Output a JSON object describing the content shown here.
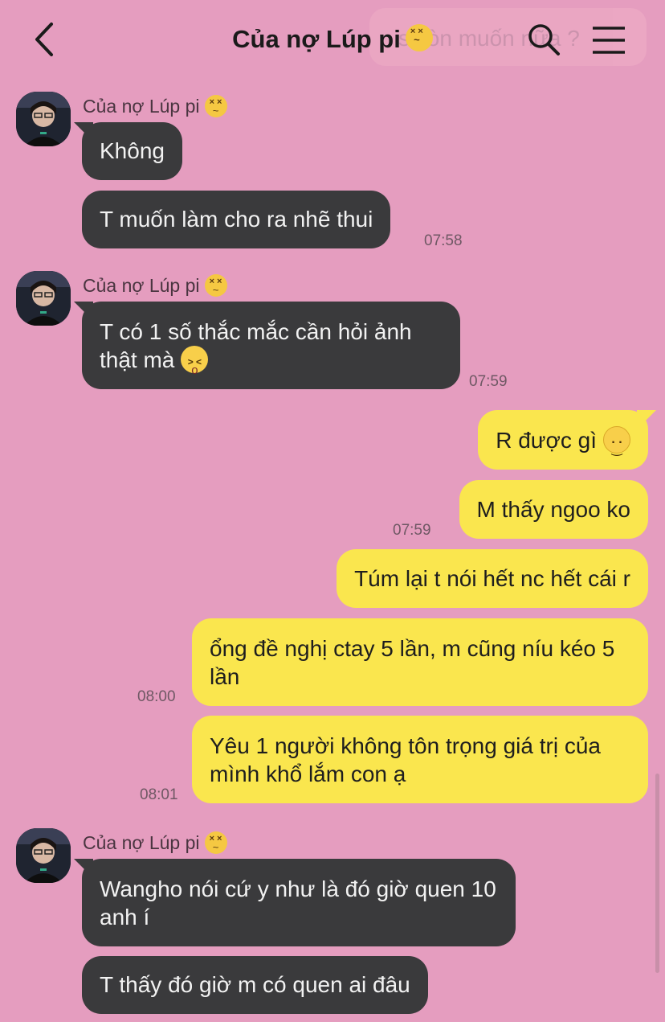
{
  "header": {
    "title": "Của nợ Lúp pi",
    "ghost_preview": "s còn muốn nữa ?"
  },
  "contact": {
    "name": "Của nợ Lúp pi",
    "name_emoji": "confounded-face"
  },
  "messages": {
    "m1": "Không",
    "m2": "T muốn làm cho ra nhẽ thui",
    "t2": "07:58",
    "m3": "T có 1 số thắc mắc cần hỏi ảnh thật mà",
    "t3": "07:59",
    "m4": "R được gì",
    "m5": "M thấy ngoo ko",
    "t5": "07:59",
    "m6": "Túm lại t nói hết nc hết cái r",
    "m7": "ổng đề nghị ctay 5 lần, m cũng níu kéo 5 lần",
    "t7": "08:00",
    "m8": "Yêu 1 người không tôn trọng giá trị của mình khổ lắm con ạ",
    "t8": "08:01",
    "m9": "Wangho nói cứ y như là đó giờ quen 10 anh í",
    "m10": "T thấy đó giờ m có quen ai đâu"
  },
  "colors": {
    "background": "#E59DBF",
    "incoming": "#3A3A3C",
    "outgoing": "#FAE64E"
  },
  "icons": [
    "back-icon",
    "search-icon",
    "menu-icon",
    "confounded-face-emoji",
    "crying-face-emoji",
    "smiling-face-emoji"
  ]
}
